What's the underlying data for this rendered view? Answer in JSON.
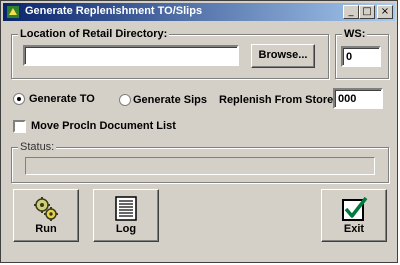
{
  "window": {
    "title": "Generate Replenishment TO/Slips"
  },
  "title_buttons": {
    "minimize": "_",
    "maximize": "□",
    "close": "×"
  },
  "location_group": {
    "label": "Location of Retail Directory:",
    "path_value": "",
    "browse_label": "Browse..."
  },
  "ws_group": {
    "label": "WS:",
    "value": "0"
  },
  "options": {
    "generate_to_label": "Generate TO",
    "generate_to_selected": true,
    "generate_sips_label": "Generate Sips",
    "generate_sips_selected": false,
    "replenish_label": "Replenish From Store:",
    "replenish_value": "000",
    "move_list_label": "Move Procln Document List",
    "move_list_checked": false
  },
  "status_group": {
    "label": "Status:",
    "status_text": ""
  },
  "actions": {
    "run_label": "Run",
    "log_label": "Log",
    "exit_label": "Exit"
  },
  "colors": {
    "title_start": "#0a246a",
    "title_end": "#a6caf0",
    "face": "#d4d0c8",
    "exit_check": "#007a3d"
  },
  "icons": {
    "app": "app-icon",
    "run": "gears-icon",
    "log": "document-list-icon",
    "exit": "checkbox-exit-icon"
  }
}
